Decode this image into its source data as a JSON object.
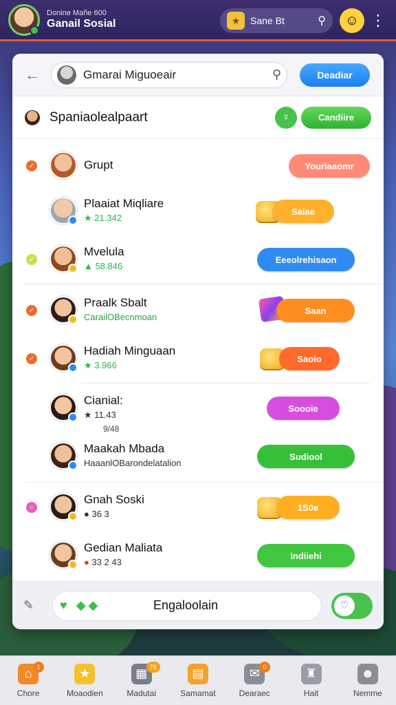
{
  "header": {
    "subtitle": "Donine Mañe 600",
    "title": "Ganail Sosial",
    "search_text": "Sane Bt",
    "avatar_icon": "profile-avatar",
    "trophy_icon": "trophy-icon",
    "search_icon": "magnifier-icon",
    "emoji_icon": "smiley-face-icon",
    "more_icon": "vertical-dots-icon"
  },
  "card": {
    "search_value": "Gmarai Miguoeair",
    "header_button": "Deadiar",
    "section_title": "Spaniaolealpaart",
    "section_button": "Candiire",
    "rows": [
      {
        "name": "Grupt",
        "meta": "",
        "meta2": "",
        "action": "Youriaaomr",
        "action_color": "#ff8a78"
      },
      {
        "name": "Plaaiat Miqliare",
        "meta": "21.342",
        "meta2": "",
        "action": "Saiae",
        "action_color": "#ffb02c"
      },
      {
        "name": "Mvelula",
        "meta": "58.846",
        "meta2": "",
        "action": "Eeeolrehisaon",
        "action_color": "#2f8bf0"
      },
      {
        "name": "Praalk Sbalt",
        "meta": "CarailOBecnmoan",
        "meta2": "",
        "action": "Saan",
        "action_color": "#ff8e1e"
      },
      {
        "name": "Hadiah Minguaan",
        "meta": "3.966",
        "meta2": "",
        "action": "Saoio",
        "action_color": "#ff6a2e"
      },
      {
        "name": "Cianial:",
        "meta": "11.43",
        "meta2": "9/48",
        "action": "Soooie",
        "action_color": "#d84de0"
      },
      {
        "name": "Maakah Mbada",
        "meta": "HaaanlOBarondelatalion",
        "meta2": "",
        "action": "Sudiool",
        "action_color": "#36c03a"
      },
      {
        "name": "Gnah Soski",
        "meta": "36 3",
        "meta2": "",
        "action": "1S0e",
        "action_color": "#ffae22"
      },
      {
        "name": "Gedian Maliata",
        "meta": "33 2 43",
        "meta2": "",
        "action": "Indiiehi",
        "action_color": "#40c640"
      }
    ],
    "footer_text": "Engaloolain"
  },
  "nav": [
    {
      "label": "Chore",
      "icon": "home-icon",
      "badge": "1"
    },
    {
      "label": "Moaodien",
      "icon": "star-icon",
      "badge": ""
    },
    {
      "label": "Madutai",
      "icon": "calendar-icon",
      "badge": "78"
    },
    {
      "label": "Samamat",
      "icon": "shop-icon",
      "badge": ""
    },
    {
      "label": "Dearaec",
      "icon": "inbox-icon",
      "badge": "0"
    },
    {
      "label": "Hait",
      "icon": "hat-icon",
      "badge": ""
    },
    {
      "label": "Nemme",
      "icon": "user-icon",
      "badge": ""
    }
  ]
}
